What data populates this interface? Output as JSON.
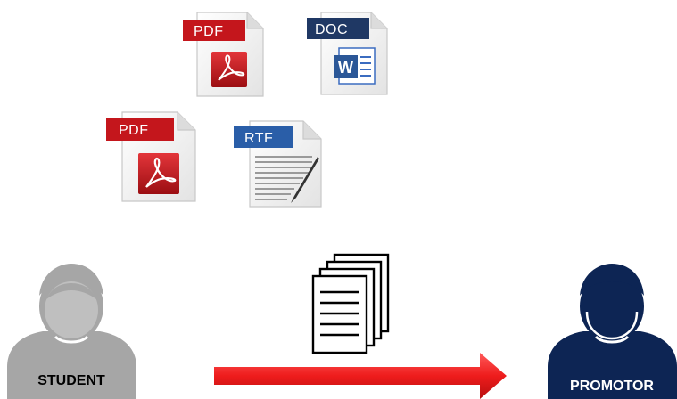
{
  "files": [
    {
      "id": "pdf-1",
      "tag": "PDF",
      "kind": "pdf",
      "tag_color": "#c4161c"
    },
    {
      "id": "doc-1",
      "tag": "DOC",
      "kind": "doc",
      "tag_color": "#1f3864"
    },
    {
      "id": "pdf-2",
      "tag": "PDF",
      "kind": "pdf",
      "tag_color": "#c4161c"
    },
    {
      "id": "rtf-1",
      "tag": "RTF",
      "kind": "rtf",
      "tag_color": "#2a5ea8"
    }
  ],
  "student": {
    "label": "STUDENT",
    "color": "#a6a6a6",
    "text_color": "#000000"
  },
  "promotor": {
    "label": "PROMOTOR",
    "color": "#0d2554",
    "text_color": "#ffffff"
  },
  "arrow": {
    "color": "#ee1c1c",
    "direction": "right"
  },
  "icons": {
    "pdf": "adobe-acrobat-icon",
    "doc": "word-document-icon",
    "rtf": "rtf-document-icon",
    "stack": "document-stack-icon",
    "person": "person-icon"
  }
}
